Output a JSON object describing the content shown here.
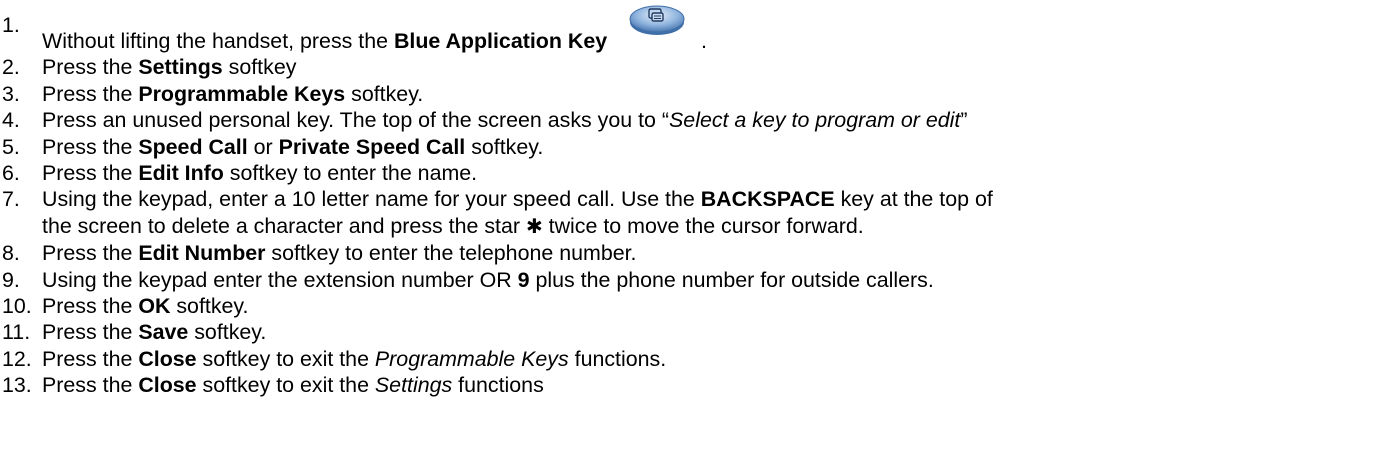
{
  "steps": [
    {
      "num": "1.",
      "lines": [
        [
          {
            "t": "Without lifting the handset, press the "
          },
          {
            "t": "Blue Application Key",
            "b": true
          },
          {
            "icon": "blue-application-key-icon"
          },
          {
            "t": "."
          }
        ]
      ]
    },
    {
      "num": "2.",
      "lines": [
        [
          {
            "t": "Press the "
          },
          {
            "t": "Settings",
            "b": true
          },
          {
            "t": " softkey"
          }
        ]
      ]
    },
    {
      "num": "3.",
      "lines": [
        [
          {
            "t": "Press the "
          },
          {
            "t": "Programmable Keys",
            "b": true
          },
          {
            "t": " softkey."
          }
        ]
      ]
    },
    {
      "num": "4.",
      "lines": [
        [
          {
            "t": "Press an unused personal key.  The top of the screen asks you to “"
          },
          {
            "t": "Select a key to program or edit",
            "i": true
          },
          {
            "t": "”"
          }
        ]
      ]
    },
    {
      "num": "5.",
      "lines": [
        [
          {
            "t": "Press the "
          },
          {
            "t": "Speed Call",
            "b": true
          },
          {
            "t": " or "
          },
          {
            "t": "Private Speed Call",
            "b": true
          },
          {
            "t": " softkey."
          }
        ]
      ]
    },
    {
      "num": "6.",
      "lines": [
        [
          {
            "t": "Press the "
          },
          {
            "t": "Edit Info",
            "b": true
          },
          {
            "t": " softkey to enter the name."
          }
        ]
      ]
    },
    {
      "num": "7.",
      "lines": [
        [
          {
            "t": "Using the keypad, enter a 10 letter name for your speed call.  Use the "
          },
          {
            "t": "BACKSPACE",
            "b": true
          },
          {
            "t": " key at the top of"
          }
        ],
        [
          {
            "t": "the screen to delete a character and press the star "
          },
          {
            "t": "✱",
            "star": true
          },
          {
            "t": " twice to move the cursor forward."
          }
        ]
      ]
    },
    {
      "num": "8.",
      "lines": [
        [
          {
            "t": "Press the "
          },
          {
            "t": "Edit Number",
            "b": true
          },
          {
            "t": " softkey to enter the telephone number."
          }
        ]
      ]
    },
    {
      "num": "9.",
      "lines": [
        [
          {
            "t": "Using the keypad enter the extension number OR "
          },
          {
            "t": "9",
            "b": true
          },
          {
            "t": " plus the phone number for outside callers."
          }
        ]
      ]
    },
    {
      "num": "10.",
      "lines": [
        [
          {
            "t": "Press the "
          },
          {
            "t": "OK",
            "b": true
          },
          {
            "t": " softkey."
          }
        ]
      ]
    },
    {
      "num": "11.",
      "lines": [
        [
          {
            "t": "Press the "
          },
          {
            "t": "Save",
            "b": true
          },
          {
            "t": " softkey."
          }
        ]
      ]
    },
    {
      "num": "12.",
      "lines": [
        [
          {
            "t": "Press the "
          },
          {
            "t": "Close",
            "b": true
          },
          {
            "t": " softkey to exit the "
          },
          {
            "t": "Programmable Keys",
            "i": true
          },
          {
            "t": " functions."
          }
        ]
      ]
    },
    {
      "num": "13.",
      "lines": [
        [
          {
            "t": "Press the "
          },
          {
            "t": "Close",
            "b": true
          },
          {
            "t": " softkey to exit the "
          },
          {
            "t": "Settings",
            "i": true
          },
          {
            "t": " functions"
          }
        ]
      ]
    }
  ],
  "colors": {
    "text": "#000000",
    "key_fill": "#8fb4de",
    "key_edge": "#3f6fa8"
  }
}
